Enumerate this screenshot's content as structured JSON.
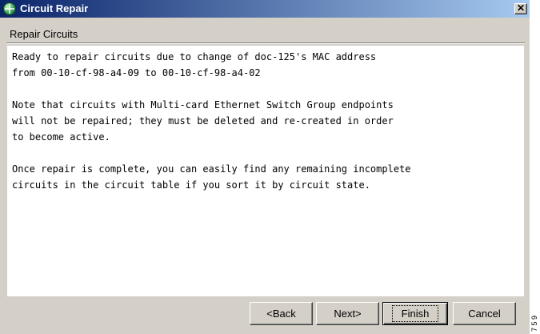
{
  "window": {
    "title": "Circuit Repair",
    "icon": "circuit-globe-icon",
    "close_glyph": "✕"
  },
  "section": {
    "label": "Repair Circuits"
  },
  "content": {
    "paragraphs": [
      "Ready to repair circuits due to change of doc-125's MAC address\nfrom 00-10-cf-98-a4-09 to 00-10-cf-98-a4-02",
      "Note that circuits with Multi-card Ethernet Switch Group endpoints\nwill not be repaired; they must be deleted and re-created in order\nto become active.",
      "Once repair is complete, you can easily find any remaining incomplete\ncircuits in the circuit table if you sort it by circuit state."
    ]
  },
  "buttons": {
    "back": "<Back",
    "next": "Next>",
    "finish": "Finish",
    "cancel": "Cancel"
  },
  "margin_note": "7 5 9"
}
